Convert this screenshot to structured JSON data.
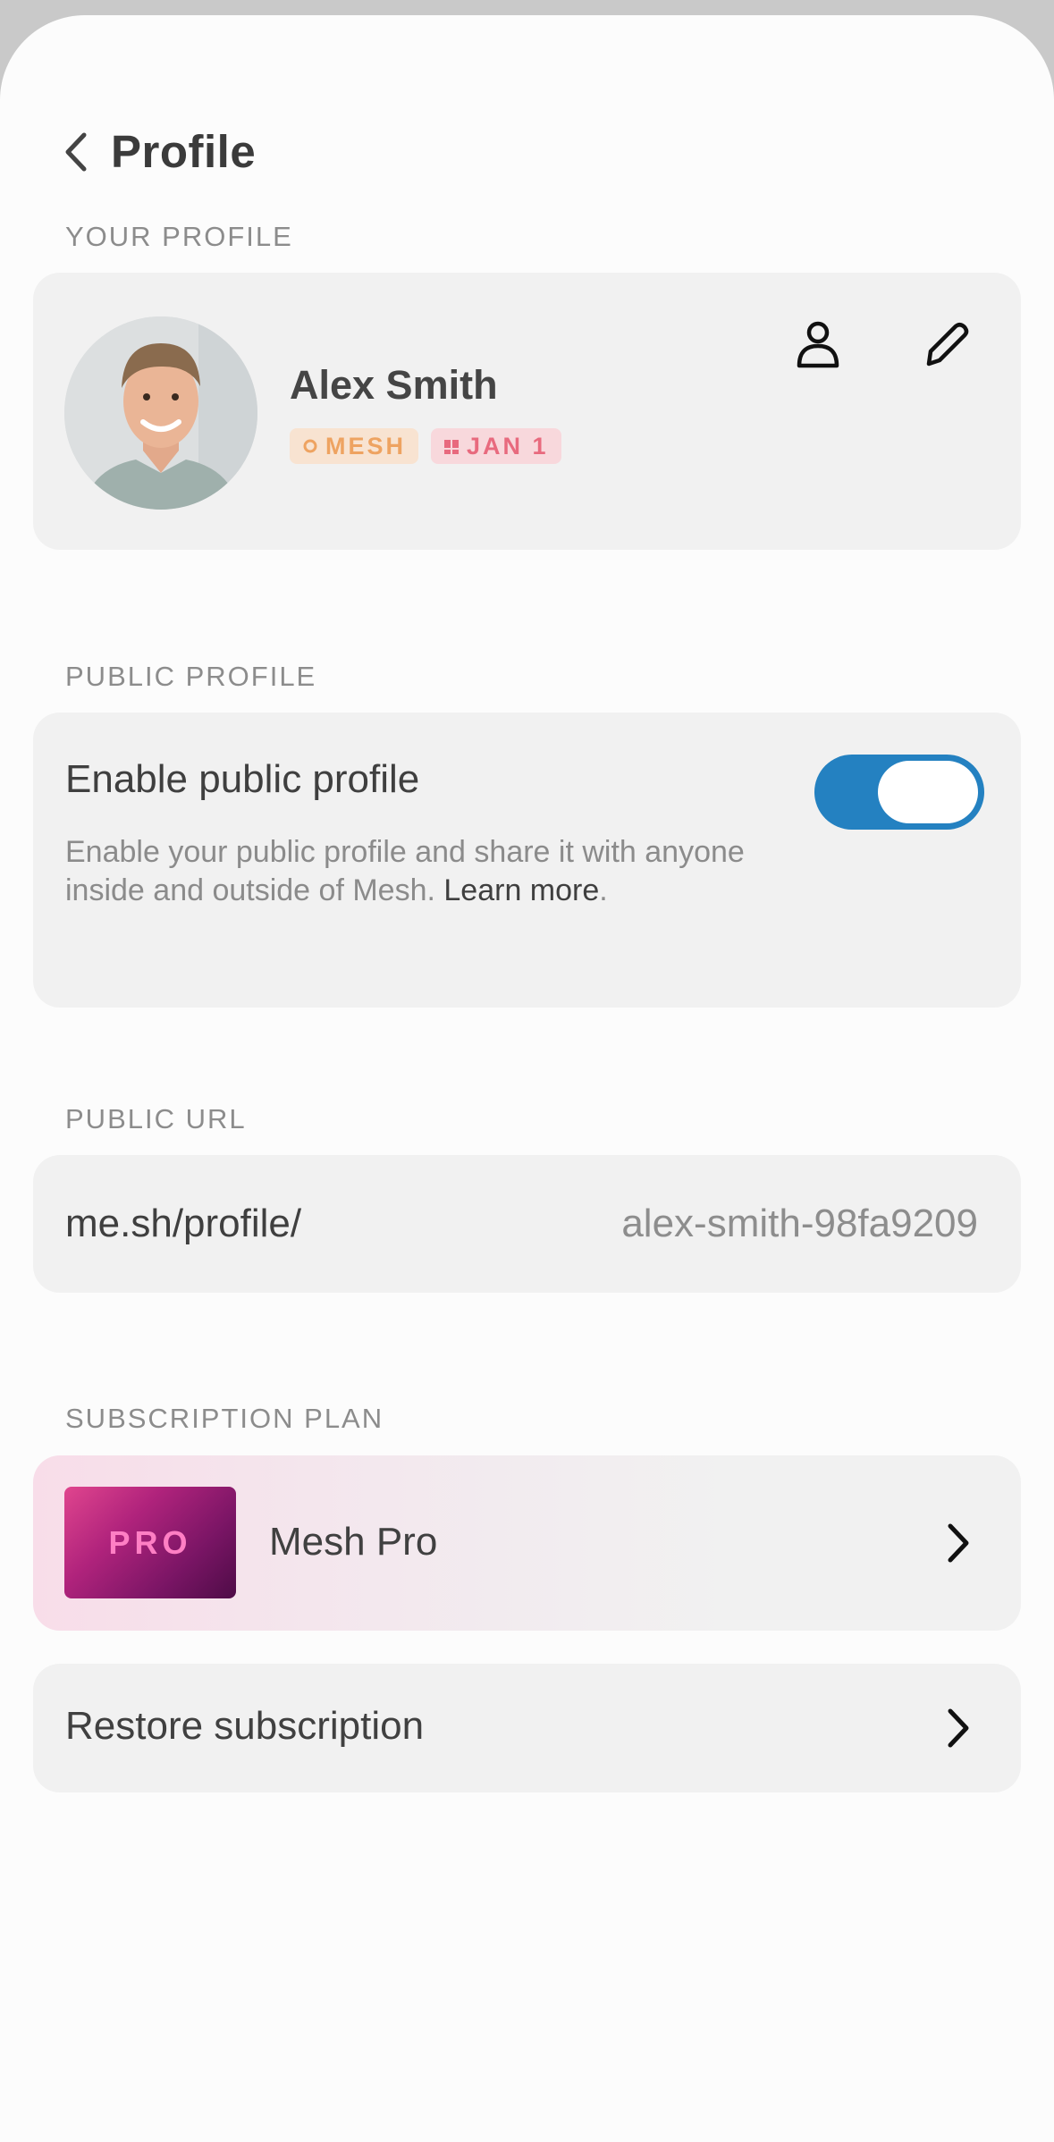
{
  "header": {
    "title": "Profile"
  },
  "profile_section": {
    "label": "YOUR PROFILE",
    "name": "Alex Smith",
    "badges": [
      {
        "text": "MESH",
        "icon": "circle-icon",
        "color": "#eea361"
      },
      {
        "text": "JAN 1",
        "icon": "gift-icon",
        "color": "#e86a7e"
      }
    ],
    "actions": [
      "person-icon",
      "pencil-icon"
    ]
  },
  "public_profile_section": {
    "label": "PUBLIC PROFILE",
    "title": "Enable public profile",
    "description": "Enable your public profile and share it with anyone inside and outside of Mesh.",
    "link_text": "Learn more",
    "trailing": ".",
    "enabled": true,
    "accent_color": "#2481c1"
  },
  "public_url_section": {
    "label": "PUBLIC URL",
    "prefix": "me.sh/profile/",
    "value": "alex-smith-98fa9209"
  },
  "subscription_section": {
    "label": "SUBSCRIPTION PLAN",
    "tile_text": "PRO",
    "plan_name": "Mesh Pro",
    "restore_label": "Restore subscription"
  }
}
